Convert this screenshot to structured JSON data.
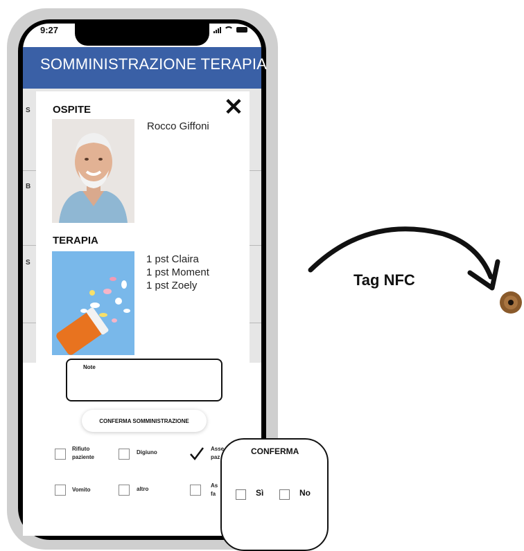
{
  "status_bar": {
    "time": "9:27"
  },
  "app": {
    "title": "SOMMINISTRAZIONE TERAPIA"
  },
  "background_rows": {
    "letters": [
      "S",
      "B",
      "S"
    ]
  },
  "modal": {
    "guest": {
      "section_title": "OSPITE",
      "name": "Rocco Giffoni"
    },
    "therapy": {
      "section_title": "TERAPIA",
      "drugs": [
        "1 pst Claira",
        "1 pst Moment",
        "1 pst Zoely"
      ]
    },
    "note": {
      "label": "Note"
    },
    "confirm_button": "CONFERMA SOMMINISTRAZIONE",
    "options": {
      "rifiuto": {
        "line1": "Rifiuto",
        "line2": "paziente"
      },
      "digiuno": "Digiuno",
      "assente": {
        "line1": "Asse",
        "line2": "paz"
      },
      "vomito": "Vomito",
      "altro": "altro",
      "as": {
        "line1": "As",
        "line2": "fa"
      }
    },
    "assente_checked": true
  },
  "confirm_popup": {
    "title": "CONFERMA",
    "yes": "Sì",
    "no": "No"
  },
  "nfc": {
    "label": "Tag NFC"
  },
  "icons": [
    "close-icon",
    "check-icon",
    "nfc-tag-icon",
    "curved-arrow-icon"
  ],
  "colors": {
    "header": "#3a60a6",
    "tag": "#8a5a2b"
  }
}
